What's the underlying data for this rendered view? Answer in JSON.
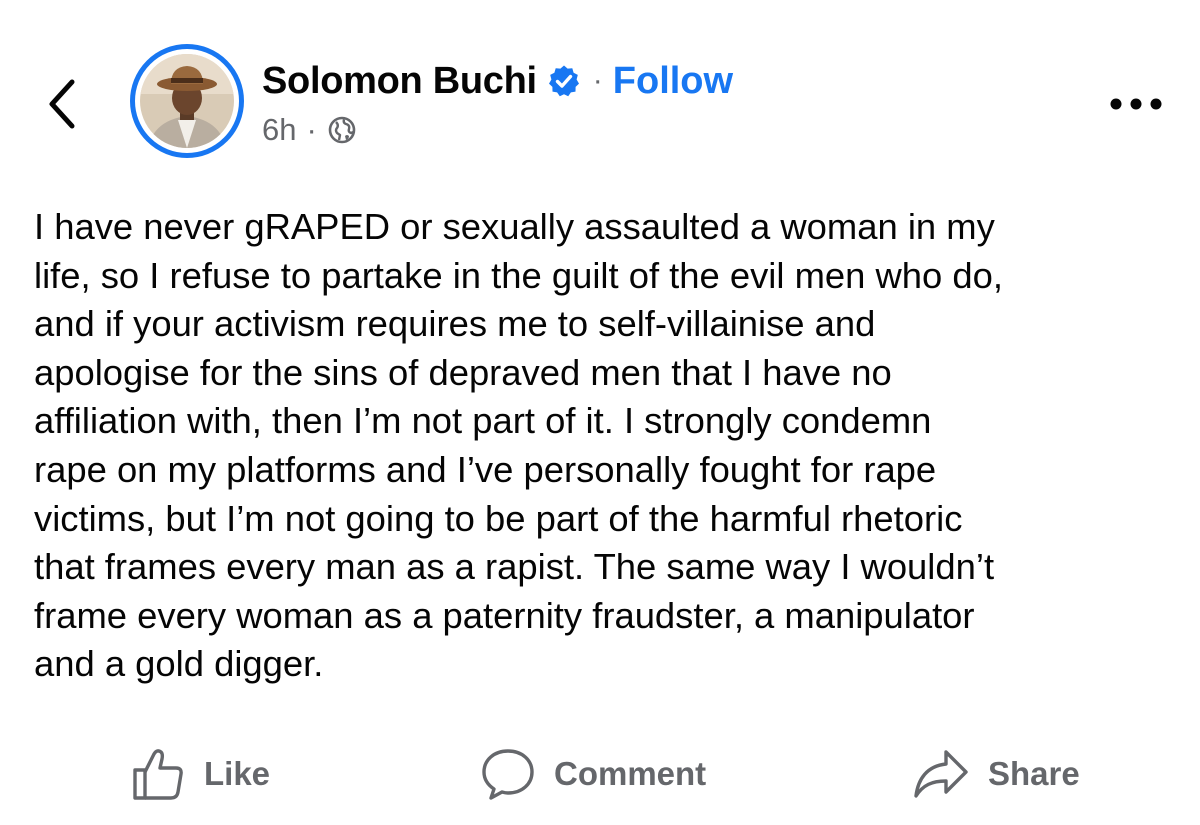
{
  "header": {
    "back_icon": "chevron-left-icon",
    "author_name": "Solomon Buchi",
    "verified_icon": "verified-badge-icon",
    "separator": "·",
    "follow_label": "Follow",
    "timestamp": "6h",
    "meta_separator": "·",
    "audience_icon": "globe-icon",
    "more_icon": "more-horizontal-icon"
  },
  "post": {
    "lines": [
      "I have never gRAPED or sexually assaulted a woman in my",
      "life, so I refuse to partake in the guilt of the evil men who do,",
      "and if your activism requires me to self-villainise and",
      "apologise for the sins of depraved men that I have no",
      "affiliation with, then I’m not part of it. I strongly condemn",
      "rape on my platforms and I’ve personally fought for rape",
      "victims, but I’m not going to be part of the harmful rhetoric",
      "that frames every man as a rapist. The same way I wouldn’t",
      "frame every woman as a paternity fraudster, a manipulator",
      "and a gold digger."
    ]
  },
  "actions": {
    "like_label": "Like",
    "like_icon": "thumbs-up-icon",
    "comment_label": "Comment",
    "comment_icon": "speech-bubble-icon",
    "share_label": "Share",
    "share_icon": "share-arrow-icon"
  },
  "colors": {
    "accent": "#1877f2",
    "secondary_text": "#65676b",
    "primary_text": "#050505"
  }
}
